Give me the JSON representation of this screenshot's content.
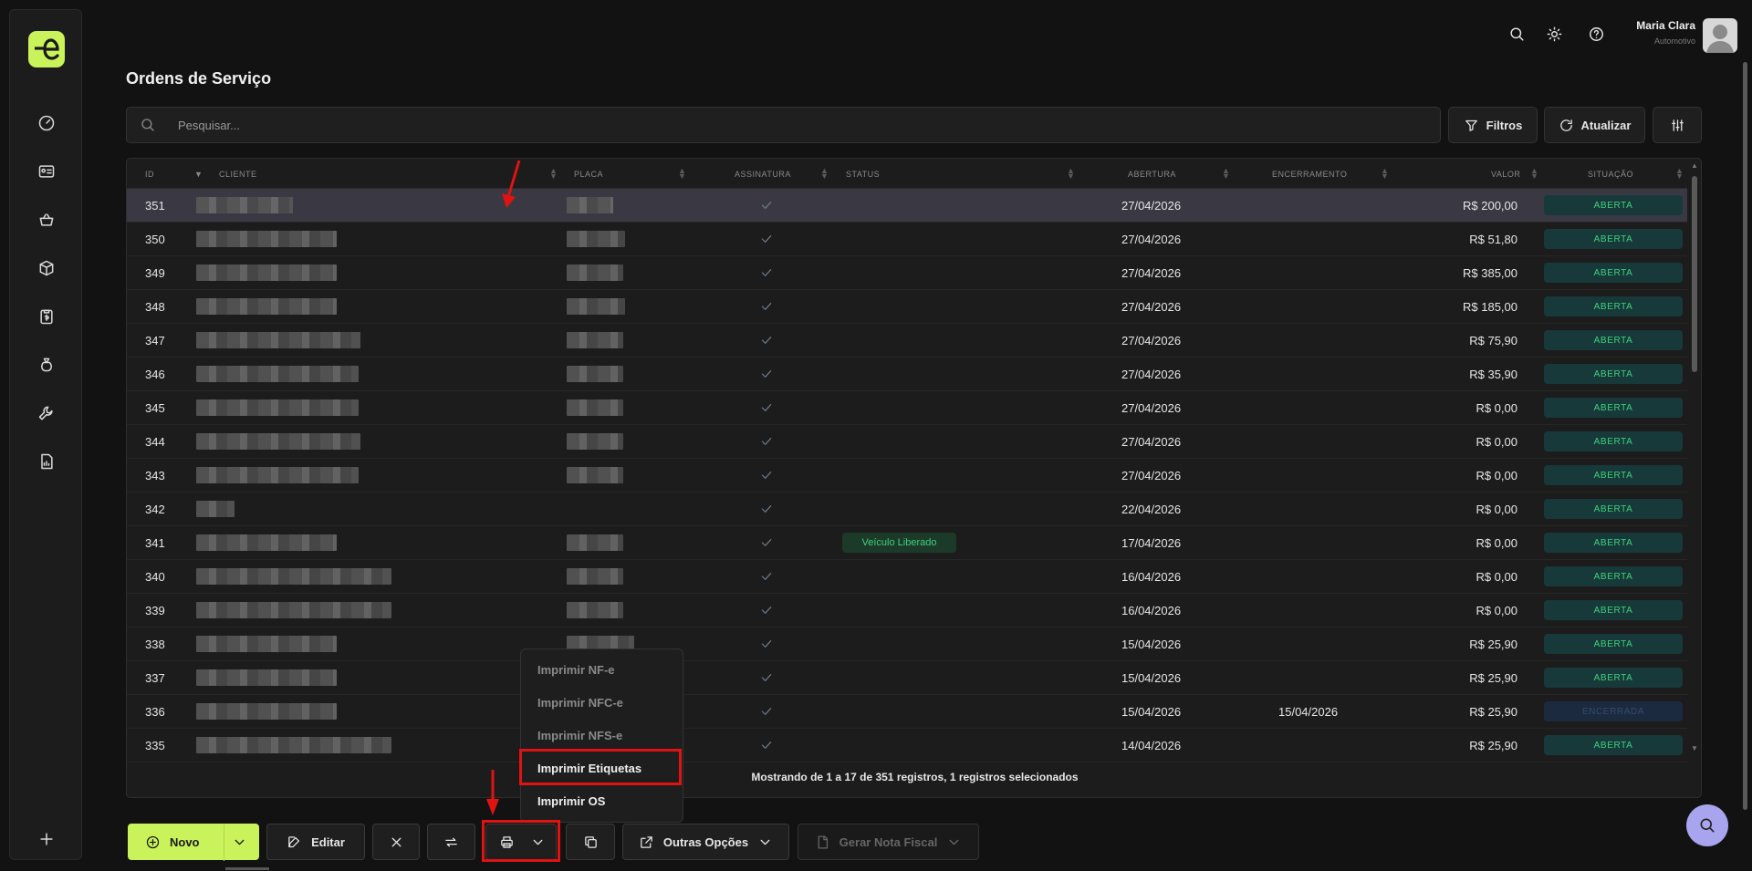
{
  "page": {
    "title": "Ordens de Serviço"
  },
  "user": {
    "name": "Maria Clara",
    "subtitle": "Automotivo"
  },
  "search": {
    "placeholder": "Pesquisar..."
  },
  "actions": {
    "filters": "Filtros",
    "refresh": "Atualizar"
  },
  "table": {
    "headers": {
      "id": "ID",
      "cliente": "CLIENTE",
      "placa": "PLACA",
      "assinatura": "ASSINATURA",
      "status": "STATUS",
      "abertura": "ABERTURA",
      "encerramento": "ENCERRAMENTO",
      "valor": "VALOR",
      "situacao": "SITUAÇÃO"
    },
    "rows": [
      {
        "id": "351",
        "status": "",
        "abertura": "27/04/2026",
        "encerramento": "",
        "valor": "R$ 200,00",
        "situacao": "ABERTA"
      },
      {
        "id": "350",
        "status": "",
        "abertura": "27/04/2026",
        "encerramento": "",
        "valor": "R$ 51,80",
        "situacao": "ABERTA"
      },
      {
        "id": "349",
        "status": "",
        "abertura": "27/04/2026",
        "encerramento": "",
        "valor": "R$ 385,00",
        "situacao": "ABERTA"
      },
      {
        "id": "348",
        "status": "",
        "abertura": "27/04/2026",
        "encerramento": "",
        "valor": "R$ 185,00",
        "situacao": "ABERTA"
      },
      {
        "id": "347",
        "status": "",
        "abertura": "27/04/2026",
        "encerramento": "",
        "valor": "R$ 75,90",
        "situacao": "ABERTA"
      },
      {
        "id": "346",
        "status": "",
        "abertura": "27/04/2026",
        "encerramento": "",
        "valor": "R$ 35,90",
        "situacao": "ABERTA"
      },
      {
        "id": "345",
        "status": "",
        "abertura": "27/04/2026",
        "encerramento": "",
        "valor": "R$ 0,00",
        "situacao": "ABERTA"
      },
      {
        "id": "344",
        "status": "",
        "abertura": "27/04/2026",
        "encerramento": "",
        "valor": "R$ 0,00",
        "situacao": "ABERTA"
      },
      {
        "id": "343",
        "status": "",
        "abertura": "27/04/2026",
        "encerramento": "",
        "valor": "R$ 0,00",
        "situacao": "ABERTA"
      },
      {
        "id": "342",
        "status": "",
        "abertura": "22/04/2026",
        "encerramento": "",
        "valor": "R$ 0,00",
        "situacao": "ABERTA"
      },
      {
        "id": "341",
        "status": "Veículo Liberado",
        "abertura": "17/04/2026",
        "encerramento": "",
        "valor": "R$ 0,00",
        "situacao": "ABERTA"
      },
      {
        "id": "340",
        "status": "",
        "abertura": "16/04/2026",
        "encerramento": "",
        "valor": "R$ 0,00",
        "situacao": "ABERTA"
      },
      {
        "id": "339",
        "status": "",
        "abertura": "16/04/2026",
        "encerramento": "",
        "valor": "R$ 0,00",
        "situacao": "ABERTA"
      },
      {
        "id": "338",
        "status": "",
        "abertura": "15/04/2026",
        "encerramento": "",
        "valor": "R$ 25,90",
        "situacao": "ABERTA"
      },
      {
        "id": "337",
        "status": "",
        "abertura": "15/04/2026",
        "encerramento": "",
        "valor": "R$ 25,90",
        "situacao": "ABERTA"
      },
      {
        "id": "336",
        "status": "",
        "abertura": "15/04/2026",
        "encerramento": "15/04/2026",
        "valor": "R$ 25,90",
        "situacao": "ENCERRADA"
      },
      {
        "id": "335",
        "status": "",
        "abertura": "14/04/2026",
        "encerramento": "",
        "valor": "R$ 25,90",
        "situacao": "ABERTA"
      }
    ],
    "footer": "Mostrando de 1 a 17 de 351 registros, 1 registros selecionados"
  },
  "print_menu": {
    "items": [
      "Imprimir NF-e",
      "Imprimir NFC-e",
      "Imprimir NFS-e",
      "Imprimir Etiquetas",
      "Imprimir OS"
    ]
  },
  "toolbar": {
    "novo": "Novo",
    "editar": "Editar",
    "outras": "Outras Opções",
    "gerar_nf": "Gerar Nota Fiscal"
  },
  "colors": {
    "accent": "#c9f25b",
    "open_badge_text": "#3fd27b",
    "annotation": "#e01212",
    "fab": "#a9a4ee"
  }
}
